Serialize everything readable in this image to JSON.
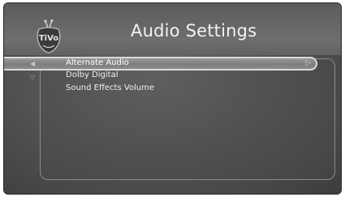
{
  "screen": {
    "title": "Audio Settings"
  },
  "menu": {
    "items": [
      {
        "label": "Alternate Audio",
        "selected": true
      },
      {
        "label": "Dolby Digital",
        "selected": false
      },
      {
        "label": "Sound Effects Volume",
        "selected": false
      }
    ]
  },
  "icons": {
    "logo": "tivo-logo-icon",
    "left": "arrow-left-icon",
    "right": "arrow-right-icon",
    "down": "arrow-down-icon"
  },
  "colors": {
    "background": "#555555",
    "highlight": "#8c8c8c",
    "text": "#f0f0f0"
  }
}
